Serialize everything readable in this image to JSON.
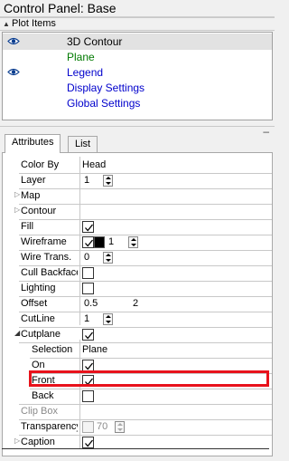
{
  "window": {
    "title": "Control Panel: Base"
  },
  "plot_items": {
    "header": "Plot Items",
    "items": [
      {
        "label": "3D Contour",
        "color": "#000000",
        "visible": true,
        "selected": true
      },
      {
        "label": "Plane",
        "color": "#007a00",
        "visible": false,
        "selected": false
      },
      {
        "label": "Legend",
        "color": "#0000cc",
        "visible": true,
        "selected": false
      },
      {
        "label": "Display Settings",
        "color": "#0000cc",
        "visible": false,
        "selected": false
      },
      {
        "label": "Global Settings",
        "color": "#0000cc",
        "visible": false,
        "selected": false
      }
    ]
  },
  "tabs": {
    "attributes": "Attributes",
    "list": "List",
    "active": "Attributes"
  },
  "attributes": {
    "color_by": {
      "label": "Color By",
      "value": "Head"
    },
    "layer": {
      "label": "Layer",
      "value": "1"
    },
    "map": {
      "label": "Map"
    },
    "contour": {
      "label": "Contour"
    },
    "fill": {
      "label": "Fill",
      "checked": true
    },
    "wireframe": {
      "label": "Wireframe",
      "checked": true,
      "color": "#000000",
      "width": "1"
    },
    "wire_trans": {
      "label": "Wire Trans.",
      "value": "0"
    },
    "cull_backface": {
      "label": "Cull Backface",
      "checked": false
    },
    "lighting": {
      "label": "Lighting",
      "checked": false
    },
    "offset": {
      "label": "Offset",
      "value1": "0.5",
      "value2": "2"
    },
    "cutline": {
      "label": "CutLine",
      "value": "1"
    },
    "cutplane": {
      "label": "Cutplane",
      "checked": true,
      "selection": {
        "label": "Selection",
        "value": "Plane"
      },
      "on": {
        "label": "On",
        "checked": true
      },
      "front": {
        "label": "Front",
        "checked": true
      },
      "back": {
        "label": "Back",
        "checked": false
      }
    },
    "clip_box": {
      "label": "Clip Box"
    },
    "transparency": {
      "label": "Transparency",
      "checked": false,
      "value": "70"
    },
    "caption": {
      "label": "Caption",
      "checked": true
    }
  },
  "colors": {
    "highlight": "#e8121b",
    "selected_row": "#e2e2e2",
    "eye_icon": "#0a3d8f"
  }
}
